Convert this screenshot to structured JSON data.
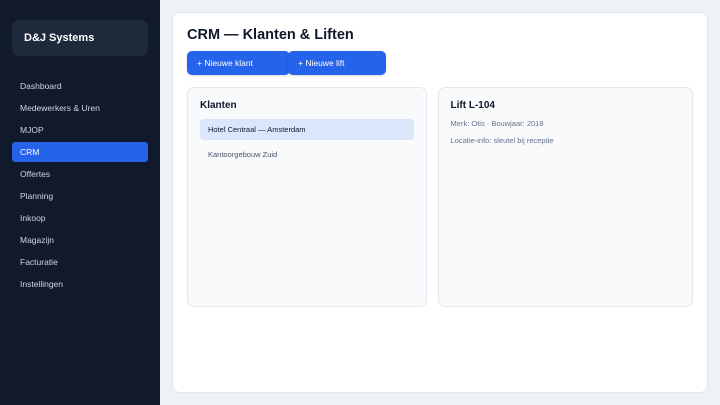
{
  "sidebar": {
    "brand": "D&J Systems",
    "items": [
      {
        "label": "Dashboard"
      },
      {
        "label": "Medewerkers & Uren"
      },
      {
        "label": "MJOP"
      },
      {
        "label": "CRM"
      },
      {
        "label": "Offertes"
      },
      {
        "label": "Planning"
      },
      {
        "label": "Inkoop"
      },
      {
        "label": "Magazijn"
      },
      {
        "label": "Facturatie"
      },
      {
        "label": "Instellingen"
      }
    ],
    "active_item": "CRM"
  },
  "main": {
    "title": "CRM — Klanten & Liften",
    "buttons": {
      "new_customer": "+ Nieuwe klant",
      "new_lift": "+ Nieuwe lift"
    },
    "customers": {
      "title": "Klanten",
      "items": [
        {
          "label": "Hotel Centraal — Amsterdam"
        },
        {
          "label": "Kantoorgebouw Zuid"
        }
      ],
      "selected": "Hotel Centraal — Amsterdam"
    },
    "lift": {
      "title": "Lift L-104",
      "specs": "Merk: Otis · Bouwjaar: 2018",
      "location_info": "Locatie-info: sleutel bij receptie"
    }
  },
  "colors": {
    "sidebar_bg": "#111a2b",
    "accent": "#2563eb",
    "selected_bg": "#dbe6fb"
  }
}
